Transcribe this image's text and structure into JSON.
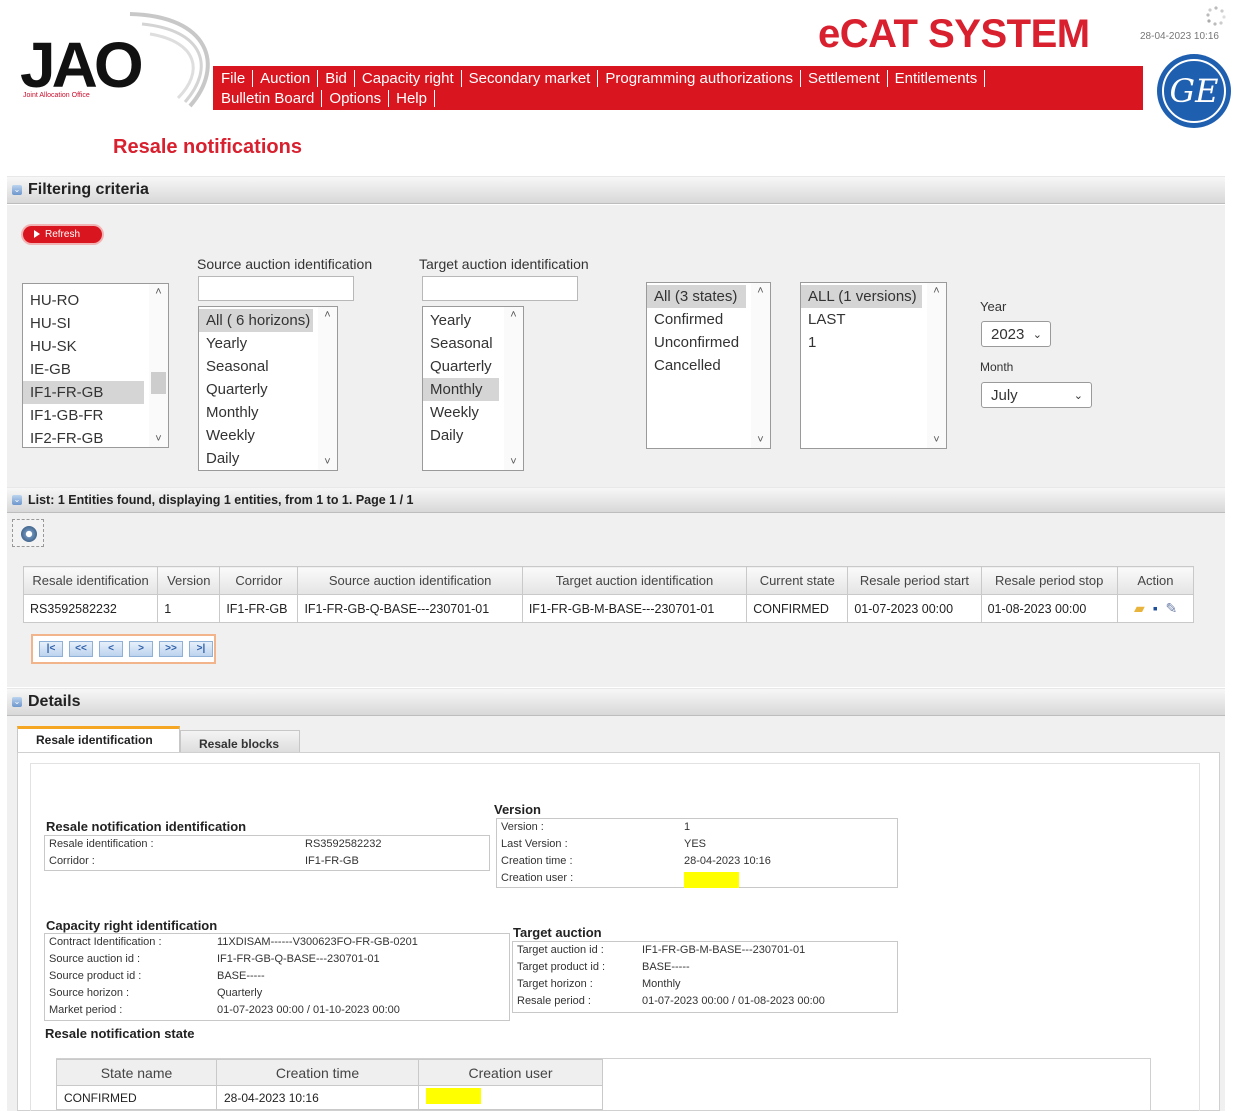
{
  "header": {
    "logo_text": "JAO",
    "logo_subtitle": "Joint Allocation Office",
    "app_title": "eCAT SYSTEM",
    "datetime": "28-04-2023 10:16",
    "partner_logo": "ge-logo",
    "menu_row1": [
      "File",
      "Auction",
      "Bid",
      "Capacity right",
      "Secondary market",
      "Programming authorizations",
      "Settlement",
      "Entitlements"
    ],
    "menu_row2": [
      "Bulletin Board",
      "Options",
      "Help"
    ]
  },
  "page_title": "Resale notifications",
  "filter": {
    "section_title": "Filtering criteria",
    "refresh_label": "Refresh",
    "corridors": [
      "HU-RO",
      "HU-SI",
      "HU-SK",
      "IE-GB",
      "IF1-FR-GB",
      "IF1-GB-FR",
      "IF2-FR-GB"
    ],
    "corridor_selected": "IF1-FR-GB",
    "source_label": "Source auction identification",
    "source_value": "",
    "source_horizons": [
      "All ( 6 horizons)",
      "Yearly",
      "Seasonal",
      "Quarterly",
      "Monthly",
      "Weekly",
      "Daily"
    ],
    "source_selected": "All ( 6 horizons)",
    "target_label": "Target auction identification",
    "target_value": "",
    "target_horizons": [
      "Yearly",
      "Seasonal",
      "Quarterly",
      "Monthly",
      "Weekly",
      "Daily"
    ],
    "target_selected": "Monthly",
    "states": [
      "All (3 states)",
      "Confirmed",
      "Unconfirmed",
      "Cancelled"
    ],
    "state_selected": "All (3 states)",
    "versions": [
      "ALL (1 versions)",
      "LAST",
      "1"
    ],
    "version_selected": "ALL (1 versions)",
    "year_label": "Year",
    "year_value": "2023",
    "month_label": "Month",
    "month_value": "July"
  },
  "list": {
    "section_title": "List: 1 Entities found, displaying 1 entities, from 1 to 1. Page 1 / 1",
    "columns": [
      "Resale identification",
      "Version",
      "Corridor",
      "Source auction identification",
      "Target auction identification",
      "Current state",
      "Resale period start",
      "Resale period stop",
      "Action"
    ],
    "rows": [
      [
        "RS3592582232",
        "1",
        "IF1-FR-GB",
        "IF1-FR-GB-Q-BASE---230701-01",
        "IF1-FR-GB-M-BASE---230701-01",
        "CONFIRMED",
        "01-07-2023 00:00",
        "01-08-2023 00:00"
      ]
    ],
    "action_icons": [
      "open-folder-icon",
      "save-icon",
      "edit-icon"
    ],
    "pager": [
      "|<",
      "<<",
      "<",
      ">",
      ">>",
      ">|"
    ]
  },
  "details": {
    "section_title": "Details",
    "tabs": [
      "Resale identification",
      "Resale blocks"
    ],
    "ident_title": "Resale notification identification",
    "ident": [
      {
        "k": "Resale identification :",
        "v": "RS3592582232"
      },
      {
        "k": "Corridor :",
        "v": "IF1-FR-GB"
      }
    ],
    "version_title": "Version",
    "version": [
      {
        "k": "Version :",
        "v": "1"
      },
      {
        "k": "Last Version :",
        "v": "YES"
      },
      {
        "k": "Creation time :",
        "v": "28-04-2023 10:16"
      },
      {
        "k": "Creation user :",
        "v": ""
      }
    ],
    "cap_title": "Capacity right identification",
    "cap": [
      {
        "k": "Contract Identification :",
        "v": "11XDISAM------V300623FO-FR-GB-0201"
      },
      {
        "k": "Source auction id :",
        "v": "IF1-FR-GB-Q-BASE---230701-01"
      },
      {
        "k": "Source product id :",
        "v": "BASE-----"
      },
      {
        "k": "Source horizon :",
        "v": "Quarterly"
      },
      {
        "k": "Market period :",
        "v": "01-07-2023 00:00 / 01-10-2023 00:00"
      }
    ],
    "target_title": "Target auction",
    "target": [
      {
        "k": "Target auction id :",
        "v": "IF1-FR-GB-M-BASE---230701-01"
      },
      {
        "k": "Target product id :",
        "v": "BASE-----"
      },
      {
        "k": "Target horizon :",
        "v": "Monthly"
      },
      {
        "k": "Resale period :",
        "v": "01-07-2023 00:00 / 01-08-2023 00:00"
      }
    ],
    "state_title": "Resale notification state",
    "state_columns": [
      "State name",
      "Creation time",
      "Creation user"
    ],
    "state_rows": [
      [
        "CONFIRMED",
        "28-04-2023 10:16",
        ""
      ]
    ],
    "highlight_color": "#ffff00"
  }
}
